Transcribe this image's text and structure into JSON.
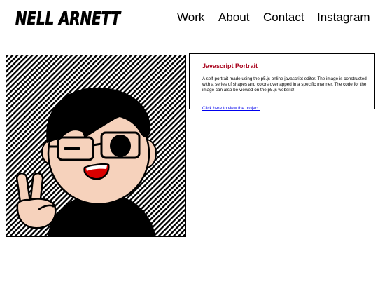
{
  "site": {
    "logo_text": "NELL ARNETT"
  },
  "nav": [
    {
      "label": "Work"
    },
    {
      "label": "About"
    },
    {
      "label": "Contact"
    },
    {
      "label": "Instagram"
    }
  ],
  "project": {
    "title": "Javascript Portrait",
    "description": "A self-portrait made using the p5.js online javascript editor. The image is constructed with a series of shapes and colors overlapped in a specific manner. The code for the image can also be viewed on the p5.js website!",
    "link_text": "Click here to view the project."
  },
  "colors": {
    "title": "#a8001a",
    "skin": "#f6d2bc",
    "hair": "#000000",
    "mouth": "#d80000",
    "link": "#0000ee"
  }
}
